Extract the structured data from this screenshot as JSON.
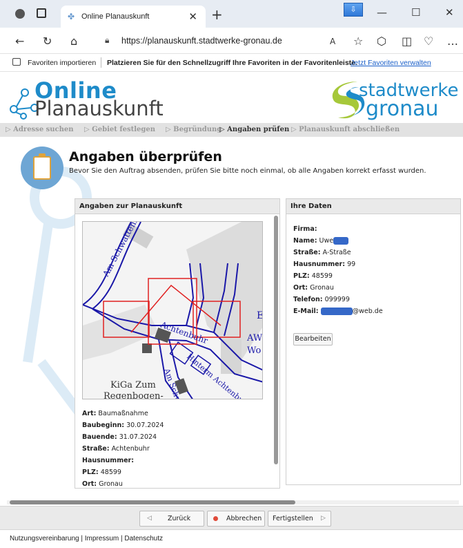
{
  "browser": {
    "tab_title": "Online Planauskunft",
    "url": "https://planauskunft.stadtwerke-gronau.de",
    "fav_import": "Favoriten importieren",
    "fav_message": "Platzieren Sie für den Schnellzugriff Ihre Favoriten in der Favoritenleiste.",
    "fav_link": "Jetzt Favoriten verwalten"
  },
  "logo": {
    "online": "Online",
    "planauskunft": "Planauskunft",
    "brand_line1": "stadtwerke",
    "brand_line2": "gronau"
  },
  "breadcrumb": [
    {
      "label": "Adresse suchen"
    },
    {
      "label": "Gebiet festlegen"
    },
    {
      "label": "Begründung"
    },
    {
      "label": "Angaben prüfen"
    },
    {
      "label": "Planauskunft abschließen"
    }
  ],
  "heading": {
    "title": "Angaben überprüfen",
    "subtitle": "Bevor Sie den Auftrag absenden, prüfen Sie bitte noch einmal, ob alle Angaben korrekt erfasst wurden."
  },
  "left_panel": {
    "header": "Angaben zur Planauskunft",
    "map_labels": [
      "Am Schwattenbach",
      "Achtenbuhr",
      "Hinterm Achtenbuhr",
      "Am Schwattenbach",
      "KiGa Zum",
      "Regenbogen-",
      "E",
      "AW",
      "Wo"
    ],
    "fields": [
      {
        "label": "Art:",
        "value": "Baumaßnahme"
      },
      {
        "label": "Baubeginn:",
        "value": "30.07.2024"
      },
      {
        "label": "Bauende:",
        "value": "31.07.2024"
      },
      {
        "label": "Straße:",
        "value": "Achtenbuhr"
      },
      {
        "label": "Hausnummer:",
        "value": ""
      },
      {
        "label": "PLZ:",
        "value": "48599"
      },
      {
        "label": "Ort:",
        "value": "Gronau"
      }
    ]
  },
  "right_panel": {
    "header": "Ihre Daten",
    "firma_label": "Firma:",
    "name_label": "Name:",
    "name_value": "Uwe",
    "strasse_label": "Straße:",
    "strasse_value": "A-Straße",
    "hausnummer_label": "Hausnummer:",
    "hausnummer_value": "99",
    "plz_label": "PLZ:",
    "plz_value": "48599",
    "ort_label": "Ort:",
    "ort_value": "Gronau",
    "telefon_label": "Telefon:",
    "telefon_value": "099999",
    "email_label": "E-Mail:",
    "email_value": "@web.de",
    "edit_button": "Bearbeiten"
  },
  "actions": {
    "back": "Zurück",
    "cancel": "Abbrechen",
    "finish": "Fertigstellen"
  },
  "footer": "Nutzungsvereinbarung | Impressum | Datenschutz"
}
